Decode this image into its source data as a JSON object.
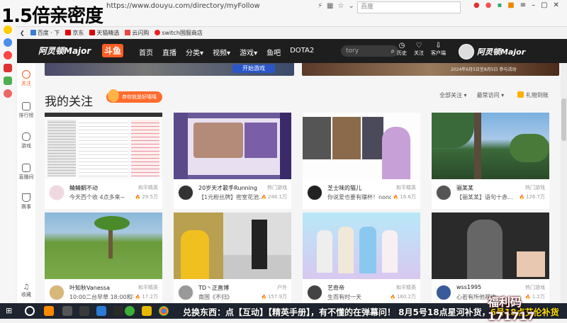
{
  "overlay": {
    "title": "1.5倍亲密度",
    "ticker_a": "兑换东西：点【互动】【精英手册】，有不懂的在弹幕问！ 8月5号18点星河补货，",
    "ticker_b": "6号18点艾伦补货",
    "fuli": "福利码171717"
  },
  "browser": {
    "url": "https://www.douyu.com/directory/myFollow",
    "search_placeholder": "百度",
    "bookmarks": [
      "百度 · 下",
      "京东",
      "天猫精选",
      "云闪购",
      "switch国服商店"
    ]
  },
  "navbar": {
    "logo": "阿灵顿Major",
    "logo2": "斗鱼",
    "items": [
      "首页",
      "直播",
      "分类",
      "视频",
      "游戏",
      "鱼吧",
      "DOTA2"
    ],
    "search_value": "tory",
    "right": [
      {
        "label": "历史",
        "icon": "clock-icon"
      },
      {
        "label": "关注",
        "icon": "heart-icon"
      },
      {
        "label": "客户端",
        "icon": "download-icon"
      }
    ],
    "user_name": "阿灵顿Major"
  },
  "sidebar": {
    "items": [
      "关注",
      "排行榜",
      "游戏",
      "直播间",
      "赛事"
    ],
    "bottom": "收藏"
  },
  "banner": {
    "button": "开始游戏",
    "text": "2024年6月5日至8月5日 参与活动"
  },
  "main": {
    "section_title": "我的关注",
    "pill": "恭你就是好嘻嘻",
    "filters": [
      "全部关注",
      "最常访问"
    ],
    "gift": "礼物到账"
  },
  "cards": [
    {
      "name": "鲭鲭鲷不动",
      "category": "和平精英",
      "title": "今天西个收 4点多来~",
      "heat": "29.5万"
    },
    {
      "name": "20岁天才歌手Running",
      "category": "热门游戏",
      "title": "【1元粉丝牌】密室花池...",
      "heat": "246.1万"
    },
    {
      "name": "芝士味的猫儿",
      "category": "和平精英",
      "title": "你说爱也要有赚杯！nono...",
      "heat": "16.6万"
    },
    {
      "name": "骊某某",
      "category": "热门游戏",
      "title": "【骊某某】语句十赤...",
      "heat": "126.7万"
    },
    {
      "name": "叶知秋Vanessa",
      "category": "和平精英",
      "title": "10:00二台早草 18:00和秋",
      "heat": "17.2万"
    },
    {
      "name": "TD丶正直博",
      "category": "户外",
      "title": "南国《不归》",
      "heat": "157.9万"
    },
    {
      "name": "艺奇帝",
      "category": "和平精英",
      "title": "生而有时一天",
      "heat": "160.2万"
    },
    {
      "name": "wss1995",
      "category": "热门游戏",
      "title": "心若有所他视也",
      "heat": "1.2万"
    }
  ]
}
